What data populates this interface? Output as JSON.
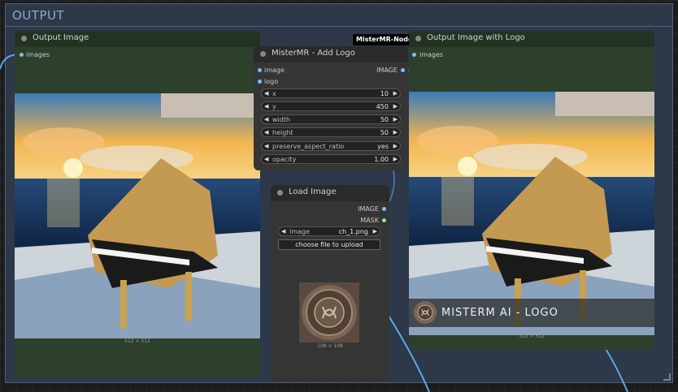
{
  "group": {
    "title": "OUTPUT"
  },
  "badge": "MisterMR-Nodes",
  "node_output": {
    "title": "Output Image",
    "input": "images",
    "size_label": "512 × 512"
  },
  "node_addlogo": {
    "title": "MisterMR - Add Logo",
    "inputs": [
      "image",
      "logo"
    ],
    "output": "IMAGE",
    "widgets": [
      {
        "label": "x",
        "value": "10"
      },
      {
        "label": "y",
        "value": "450"
      },
      {
        "label": "width",
        "value": "50"
      },
      {
        "label": "height",
        "value": "50"
      },
      {
        "label": "preserve_aspect_ratio",
        "value": "yes"
      },
      {
        "label": "opacity",
        "value": "1.00"
      }
    ]
  },
  "node_load": {
    "title": "Load Image",
    "outputs": [
      "IMAGE",
      "MASK"
    ],
    "image_widget": {
      "label": "image",
      "value": "ch_1.png"
    },
    "upload_label": "choose file to upload",
    "size_label": "108 × 108"
  },
  "node_output_logo": {
    "title": "Output Image with Logo",
    "input": "images",
    "size_label": "512 × 512",
    "logo_text": "MISTERM AI - LOGO"
  },
  "colors": {
    "group_bg": "#2d3848",
    "node_green": "#2c402c",
    "node_dark": "#353535",
    "image_slot": "#7bbff7",
    "mask_slot": "#8ee08e",
    "wire": "#5aa8e8"
  },
  "icons": [
    "arrow-left-icon",
    "arrow-right-icon",
    "node-dot-icon",
    "resize-handle-icon"
  ]
}
